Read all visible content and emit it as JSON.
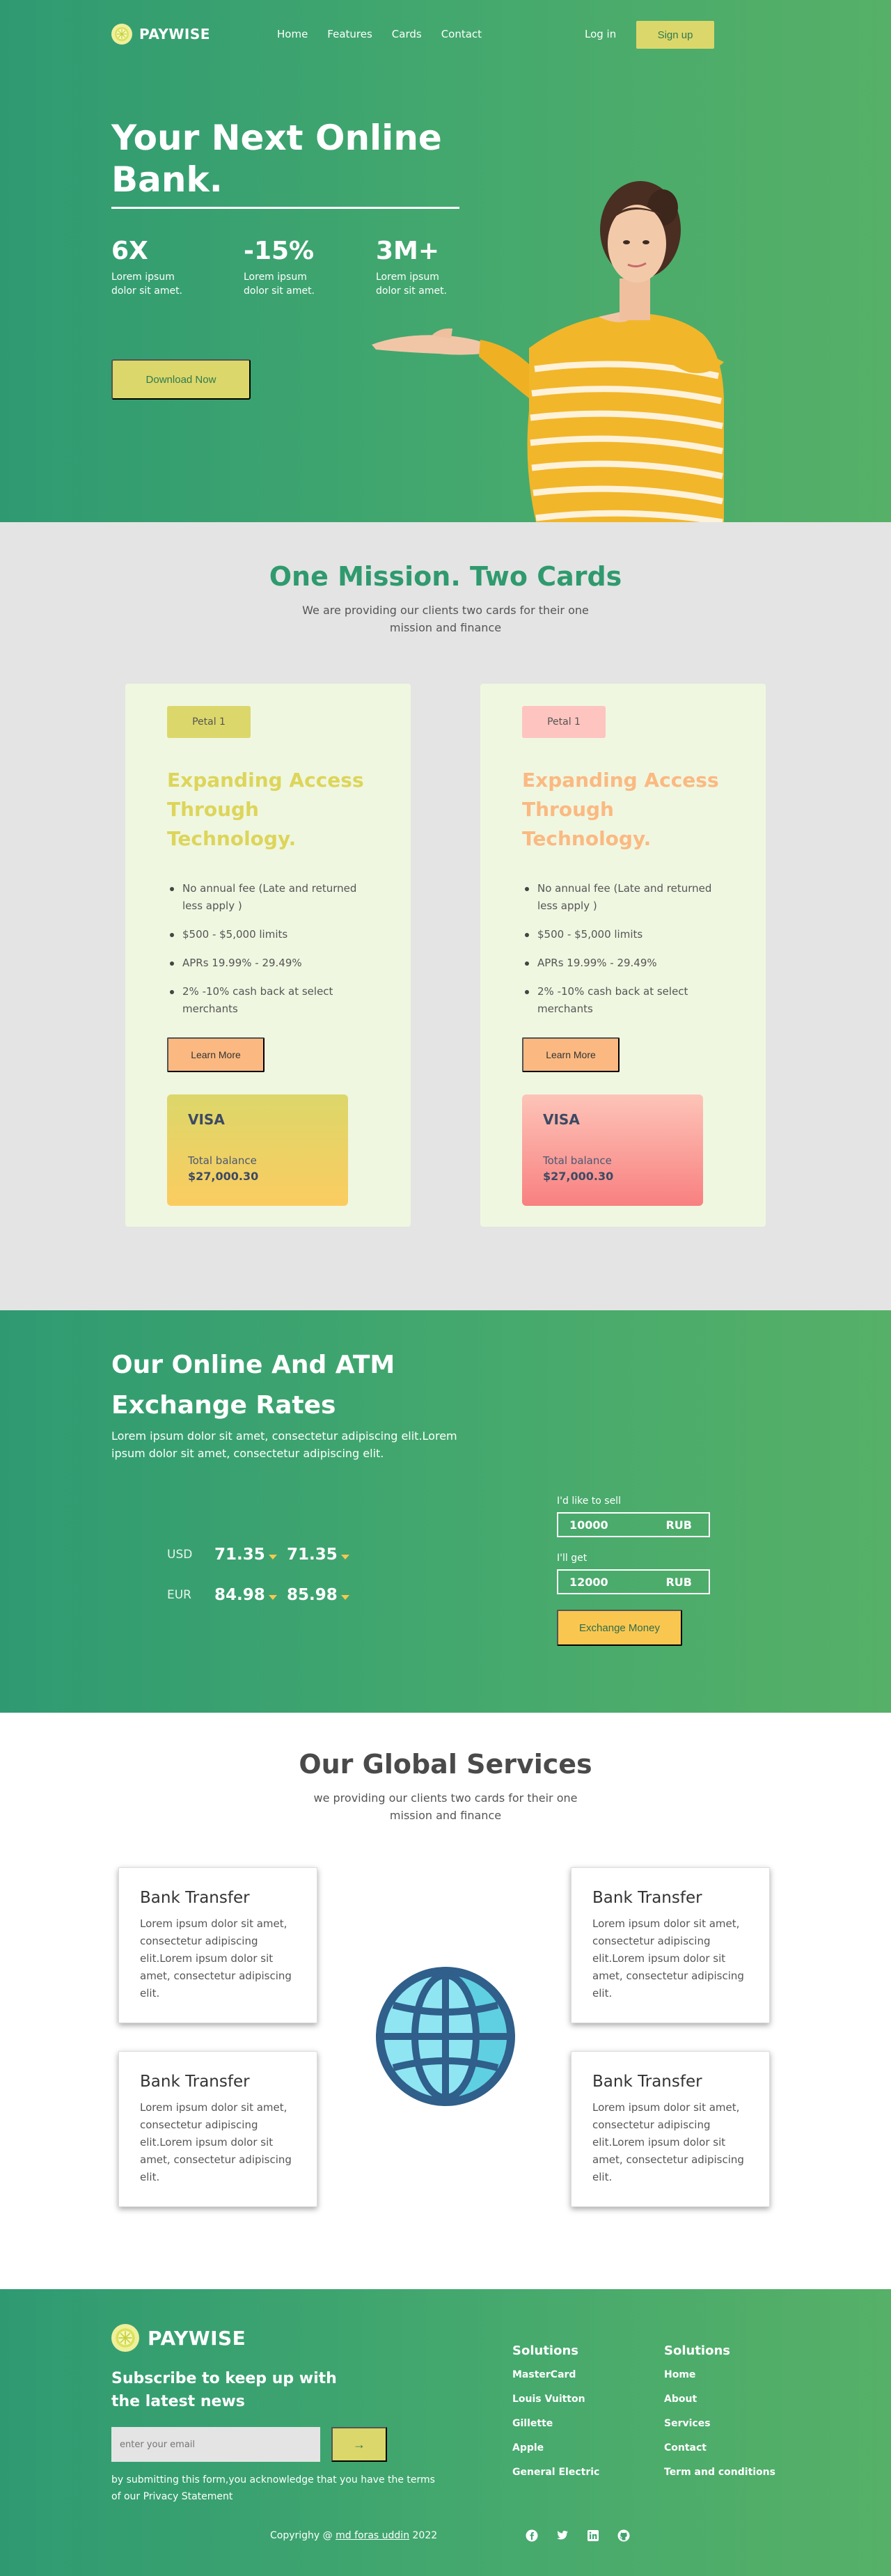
{
  "brand": {
    "name": "PAYWISE"
  },
  "nav": {
    "links": [
      "Home",
      "Features",
      "Cards",
      "Contact"
    ],
    "login": "Log in",
    "signup": "Sign up"
  },
  "hero": {
    "title": "Your Next Online Bank.",
    "stats": [
      {
        "num": "6X",
        "text": "Lorem ipsum dolor sit amet."
      },
      {
        "num": "-15%",
        "text": "Lorem ipsum dolor sit amet."
      },
      {
        "num": "3M+",
        "text": "Lorem ipsum dolor sit amet."
      }
    ],
    "cta": "Download Now"
  },
  "mission": {
    "title": "One Mission. Two Cards",
    "subtitle": "We are providing our clients two cards for their one mission and finance",
    "cards": [
      {
        "badge": "Petal 1",
        "heading": "Expanding Access Through Technology.",
        "features": [
          "No annual fee (Late and returned less apply )",
          "$500 - $5,000 limits",
          "APRs 19.99% - 29.49%",
          "2% -10% cash back at select merchants"
        ],
        "button": "Learn More",
        "visa": {
          "brand": "VISA",
          "label": "Total balance",
          "amount": "$27,000.30"
        }
      },
      {
        "badge": "Petal 1",
        "heading": "Expanding Access Through Technology.",
        "features": [
          "No annual fee (Late and returned less apply )",
          "$500 - $5,000 limits",
          "APRs 19.99% - 29.49%",
          "2% -10% cash back at select merchants"
        ],
        "button": "Learn More",
        "visa": {
          "brand": "VISA",
          "label": "Total balance",
          "amount": "$27,000.30"
        }
      }
    ]
  },
  "exchange": {
    "title": "Our Online And ATM Exchange Rates",
    "description": "Lorem ipsum dolor sit amet, consectetur adipiscing elit.Lorem ipsum dolor sit amet, consectetur adipiscing elit.",
    "rates": [
      {
        "currency": "USD",
        "buy": "71.35",
        "sell": "71.35"
      },
      {
        "currency": "EUR",
        "buy": "84.98",
        "sell": "85.98"
      }
    ],
    "sell_label": "I'd like to sell",
    "sell_value": "10000",
    "sell_currency": "RUB",
    "get_label": "I'll get",
    "get_value": "12000",
    "get_currency": "RUB",
    "button": "Exchange Money"
  },
  "services": {
    "title": "Our Global Services",
    "subtitle": "we providing our clients two cards for their one mission and finance",
    "items": [
      {
        "title": "Bank Transfer",
        "text": "Lorem ipsum dolor sit amet, consectetur adipiscing elit.Lorem ipsum dolor sit amet, consectetur adipiscing elit."
      },
      {
        "title": "Bank Transfer",
        "text": "Lorem ipsum dolor sit amet, consectetur adipiscing elit.Lorem ipsum dolor sit amet, consectetur adipiscing elit."
      },
      {
        "title": "Bank Transfer",
        "text": "Lorem ipsum dolor sit amet, consectetur adipiscing elit.Lorem ipsum dolor sit amet, consectetur adipiscing elit."
      },
      {
        "title": "Bank Transfer",
        "text": "Lorem ipsum dolor sit amet, consectetur adipiscing elit.Lorem ipsum dolor sit amet, consectetur adipiscing elit."
      }
    ]
  },
  "footer": {
    "subscribe": "Subscribe to keep up with the latest news",
    "email_placeholder": "enter your email",
    "note": "by submitting this form,you acknowledge that you have the terms of our Privacy Statement",
    "col1": {
      "title": "Solutions",
      "items": [
        "MasterCard",
        "Louis Vuitton",
        "Gillette",
        "Apple",
        "General Electric"
      ]
    },
    "col2": {
      "title": "Solutions",
      "items": [
        "Home",
        "About",
        "Services",
        "Contact",
        "Term and conditions"
      ]
    },
    "copy_prefix": "Copyrighy @ ",
    "copy_author": "md foras uddin",
    "copy_year": " 2022"
  },
  "icons": {
    "logo": "lemon-slice-icon",
    "send": "arrow-right-icon",
    "socials": [
      "facebook-icon",
      "twitter-icon",
      "linkedin-icon",
      "github-icon"
    ]
  },
  "colors": {
    "brand_green": "#2f9a72",
    "accent_yellow": "#dcd76a",
    "accent_orange": "#fbb981",
    "accent_pink": "#fdc4c0",
    "button_yellow": "#f9c74f"
  }
}
